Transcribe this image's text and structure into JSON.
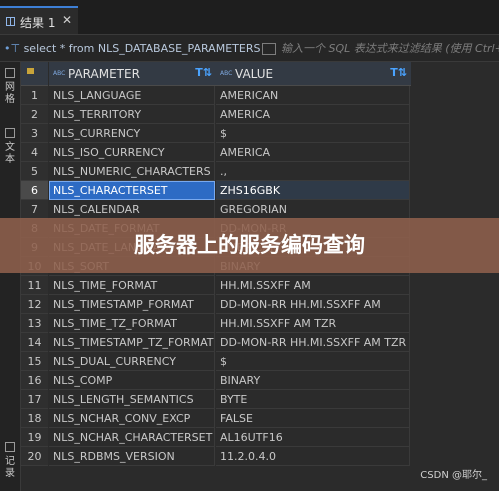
{
  "tab": {
    "label": "结果 1",
    "close": "✕"
  },
  "sql": {
    "prefix_glyph": "•⊤",
    "query": "select * from NLS_DATABASE_PARAMETERS",
    "filter_placeholder": "输入一个 SQL 表达式来过滤结果 (使用 Ctrl+"
  },
  "sidebar": {
    "grid_label": "网格",
    "text_label": "文本",
    "record_label": "记录"
  },
  "columns": [
    {
      "type": "ABC",
      "name": "PARAMETER"
    },
    {
      "type": "ABC",
      "name": "VALUE"
    }
  ],
  "rows": [
    {
      "num": "1",
      "param": "NLS_LANGUAGE",
      "value": "AMERICAN"
    },
    {
      "num": "2",
      "param": "NLS_TERRITORY",
      "value": "AMERICA"
    },
    {
      "num": "3",
      "param": "NLS_CURRENCY",
      "value": "$"
    },
    {
      "num": "4",
      "param": "NLS_ISO_CURRENCY",
      "value": "AMERICA"
    },
    {
      "num": "5",
      "param": "NLS_NUMERIC_CHARACTERS",
      "value": ".,"
    },
    {
      "num": "6",
      "param": "NLS_CHARACTERSET",
      "value": "ZHS16GBK"
    },
    {
      "num": "7",
      "param": "NLS_CALENDAR",
      "value": "GREGORIAN"
    },
    {
      "num": "8",
      "param": "NLS_DATE_FORMAT",
      "value": "DD-MON-RR"
    },
    {
      "num": "9",
      "param": "NLS_DATE_LANGUAGE",
      "value": "AMERICAN"
    },
    {
      "num": "10",
      "param": "NLS_SORT",
      "value": "BINARY"
    },
    {
      "num": "11",
      "param": "NLS_TIME_FORMAT",
      "value": "HH.MI.SSXFF AM"
    },
    {
      "num": "12",
      "param": "NLS_TIMESTAMP_FORMAT",
      "value": "DD-MON-RR HH.MI.SSXFF AM"
    },
    {
      "num": "13",
      "param": "NLS_TIME_TZ_FORMAT",
      "value": "HH.MI.SSXFF AM TZR"
    },
    {
      "num": "14",
      "param": "NLS_TIMESTAMP_TZ_FORMAT",
      "value": "DD-MON-RR HH.MI.SSXFF AM TZR"
    },
    {
      "num": "15",
      "param": "NLS_DUAL_CURRENCY",
      "value": "$"
    },
    {
      "num": "16",
      "param": "NLS_COMP",
      "value": "BINARY"
    },
    {
      "num": "17",
      "param": "NLS_LENGTH_SEMANTICS",
      "value": "BYTE"
    },
    {
      "num": "18",
      "param": "NLS_NCHAR_CONV_EXCP",
      "value": "FALSE"
    },
    {
      "num": "19",
      "param": "NLS_NCHAR_CHARACTERSET",
      "value": "AL16UTF16"
    },
    {
      "num": "20",
      "param": "NLS_RDBMS_VERSION",
      "value": "11.2.0.4.0"
    }
  ],
  "selected_row": 6,
  "banner": {
    "title": "服务器上的服务编码查询"
  },
  "watermark": "CSDN @耶尔_",
  "colors": {
    "accent": "#2d6bc4",
    "banner": "#8e604c",
    "background": "#2b2b2b"
  }
}
